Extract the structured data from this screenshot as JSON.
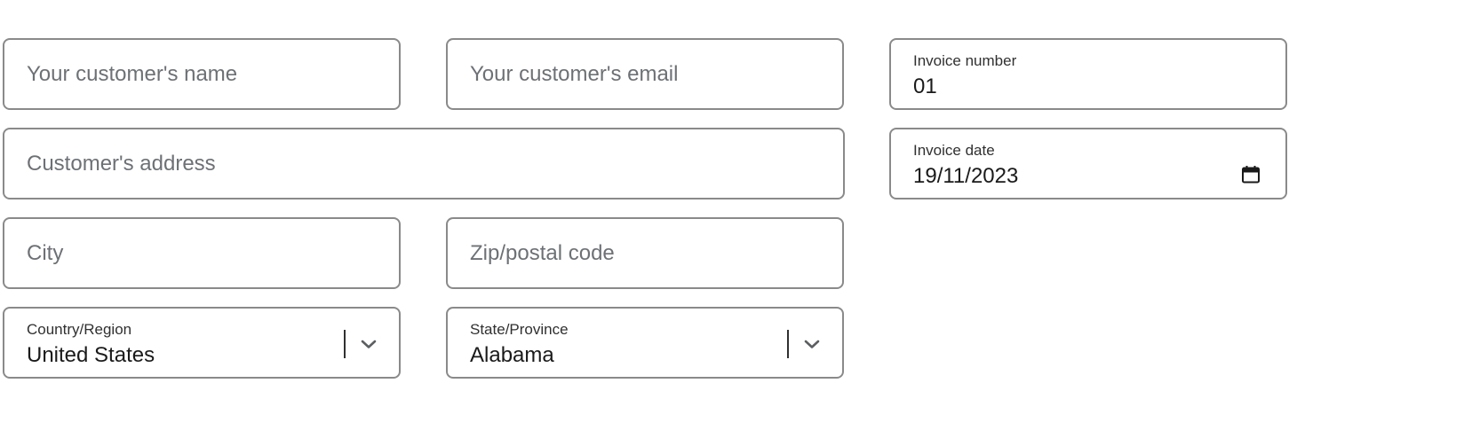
{
  "customer": {
    "name": {
      "placeholder": "Your customer's name",
      "value": ""
    },
    "email": {
      "placeholder": "Your customer's email",
      "value": ""
    },
    "address": {
      "placeholder": "Customer's address",
      "value": ""
    },
    "city": {
      "placeholder": "City",
      "value": ""
    },
    "zip": {
      "placeholder": "Zip/postal code",
      "value": ""
    },
    "country": {
      "label": "Country/Region",
      "value": "United States"
    },
    "state": {
      "label": "State/Province",
      "value": "Alabama"
    }
  },
  "invoice": {
    "number": {
      "label": "Invoice number",
      "value": "01"
    },
    "date": {
      "label": "Invoice date",
      "value": "19/11/2023"
    }
  },
  "icons": {
    "select_chevron": "chevron-down-icon",
    "date_picker": "calendar-icon"
  },
  "colors": {
    "border": "#8a8a8a",
    "placeholder": "#6d7175",
    "text": "#1a1a1a"
  }
}
